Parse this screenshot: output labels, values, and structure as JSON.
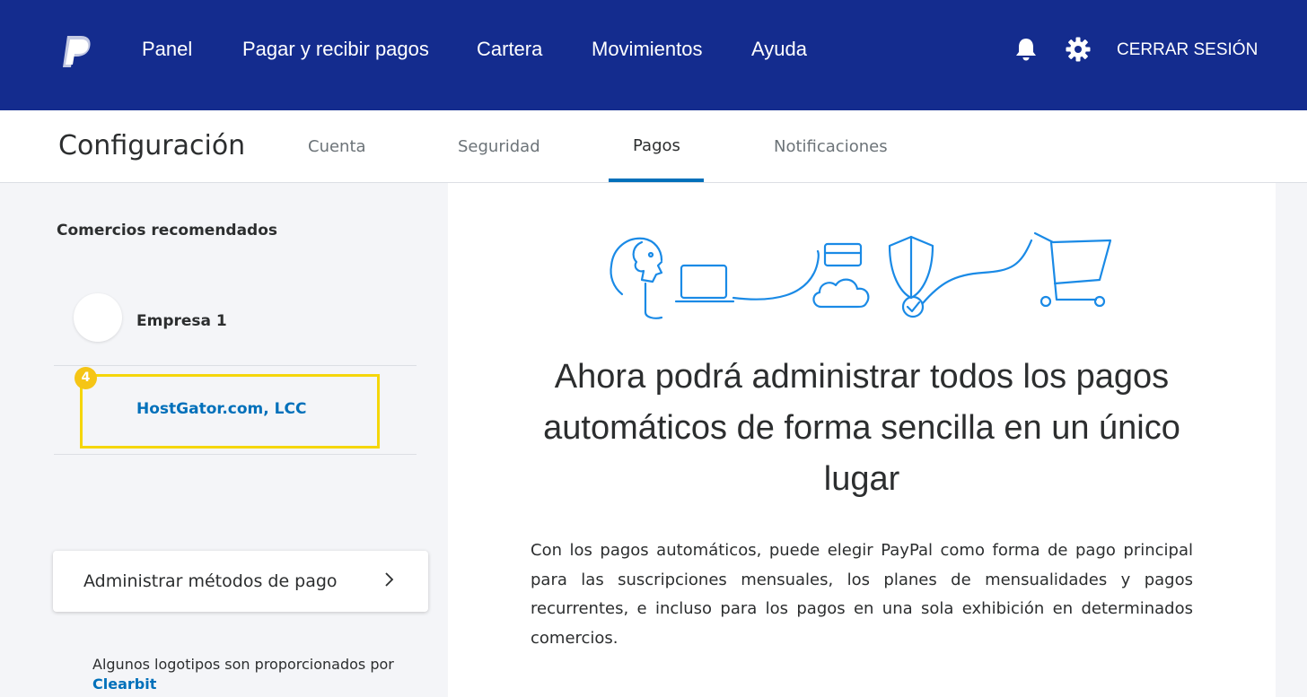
{
  "topnav": {
    "links": [
      {
        "label": "Panel"
      },
      {
        "label": "Pagar y recibir pagos"
      },
      {
        "label": "Cartera"
      },
      {
        "label": "Movimientos"
      },
      {
        "label": "Ayuda"
      }
    ],
    "logout_label": "CERRAR SESIÓN",
    "icons": [
      "bell-icon",
      "gear-icon"
    ]
  },
  "settings": {
    "title": "Configuración",
    "tabs": [
      {
        "label": "Cuenta"
      },
      {
        "label": "Seguridad"
      },
      {
        "label": "Pagos",
        "active": true
      },
      {
        "label": "Notificaciones"
      }
    ]
  },
  "sidebar": {
    "heading": "Comercios recomendados",
    "merchants": [
      {
        "name": "Empresa 1"
      },
      {
        "name": "HostGator.com, LCC"
      }
    ],
    "step_badge": "4",
    "manage_label": "Administrar métodos de pago",
    "logos_note": "Algunos logotipos son proporcionados por",
    "clearbit_label": "Clearbit"
  },
  "main": {
    "headline": "Ahora podrá administrar todos los pagos automáticos de forma sencilla en un único lugar",
    "body": "Con los pagos automáticos, puede elegir PayPal como forma de pago principal para las suscripciones mensuales, los planes de mensualidades y pagos recurrentes, e incluso para los pagos en una sola exhibición en determinados comercios."
  },
  "colors": {
    "nav_bg": "#142c8e",
    "accent": "#0070ba",
    "highlight": "#f5d60a",
    "illustration_stroke": "#1a8ae6"
  }
}
